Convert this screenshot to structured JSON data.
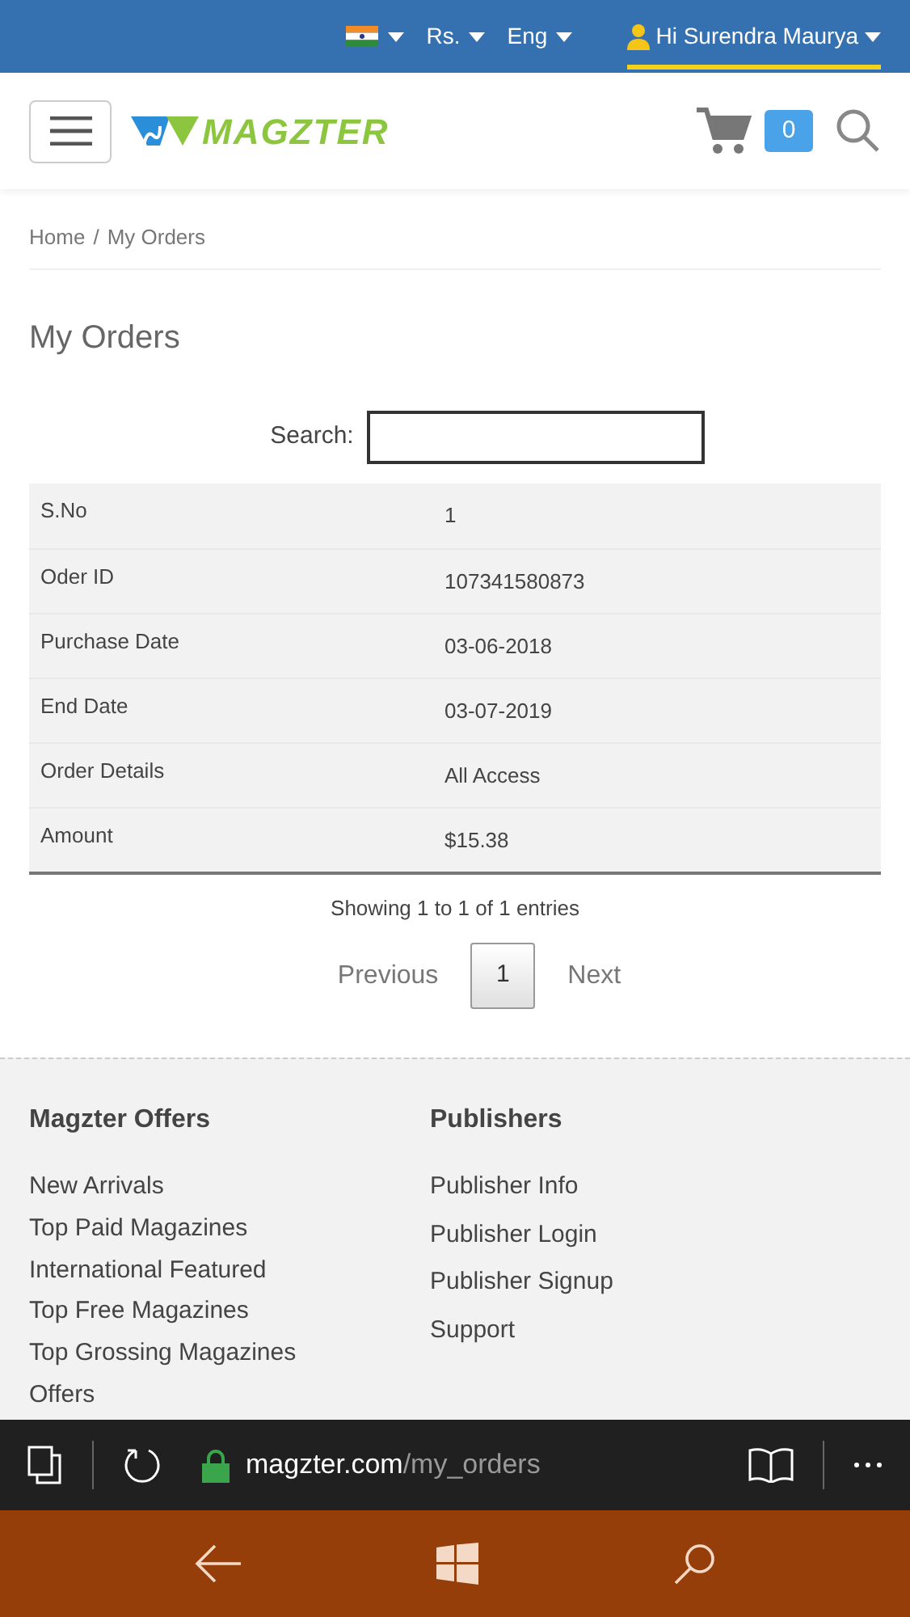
{
  "top_bar": {
    "currency": "Rs.",
    "language": "Eng",
    "user": "Hi Surendra Maurya"
  },
  "header": {
    "logo": "MAGZTER",
    "cart_count": "0"
  },
  "breadcrumbs": [
    {
      "label": "Home",
      "separator": "/"
    },
    {
      "label": "My Orders"
    }
  ],
  "page_title": "My Orders",
  "search": {
    "label": "Search:"
  },
  "table": {
    "rows": [
      {
        "label": "S.No",
        "value": "1"
      },
      {
        "label": "Oder ID",
        "value": "107341580873"
      },
      {
        "label": "Purchase Date",
        "value": "03-06-2018"
      },
      {
        "label": "End Date",
        "value": "03-07-2019"
      },
      {
        "label": "Order Details",
        "value": "All Access"
      },
      {
        "label": "Amount",
        "value": "$15.38"
      }
    ]
  },
  "table_info": "Showing 1 to 1 of 1 entries",
  "pagination": {
    "previous": "Previous",
    "pages": [
      {
        "label": "1",
        "selected": true
      }
    ],
    "next": "Next"
  },
  "footer": {
    "columns": [
      {
        "title": "Magzter Offers",
        "links": [
          "New Arrivals",
          "Top Paid Magazines",
          "International Featured",
          "Top Free Magazines",
          "Top Grossing Magazines",
          "Offers"
        ]
      },
      {
        "title": "Publishers",
        "links": [
          "Publisher Info",
          "Publisher Login",
          "Publisher Signup",
          "Support"
        ]
      }
    ]
  },
  "browser": {
    "url_host": "magzter.com",
    "url_path": "/my_orders"
  }
}
